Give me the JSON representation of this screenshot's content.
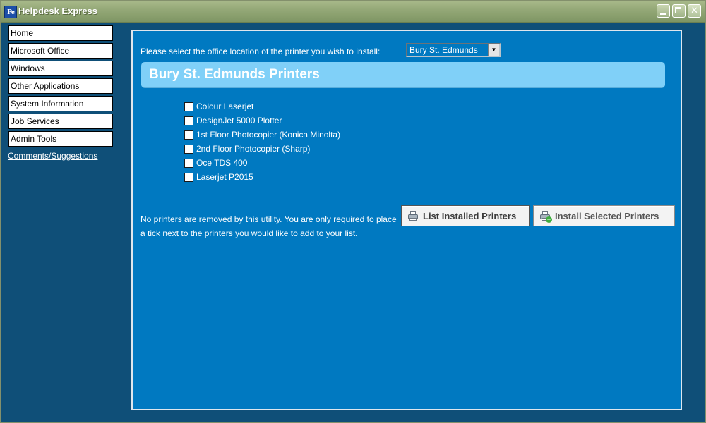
{
  "window": {
    "title": "Helpdesk Express",
    "icon_text": "Pe",
    "controls": {
      "minimize": "",
      "maximize": "",
      "close": "✕"
    }
  },
  "sidebar": {
    "items": [
      {
        "label": "Home"
      },
      {
        "label": "Microsoft Office"
      },
      {
        "label": "Windows"
      },
      {
        "label": "Other Applications"
      },
      {
        "label": "System Information"
      },
      {
        "label": "Job Services"
      },
      {
        "label": "Admin Tools"
      }
    ],
    "link": "Comments/Suggestions"
  },
  "main": {
    "prompt": "Please select the office location of the printer you wish to install:",
    "location_select": {
      "value": "Bury St. Edmunds"
    },
    "heading": "Bury St. Edmunds Printers",
    "printers": [
      {
        "label": "Colour Laserjet",
        "checked": false
      },
      {
        "label": "DesignJet 5000 Plotter",
        "checked": false
      },
      {
        "label": "1st Floor Photocopier (Konica Minolta)",
        "checked": false
      },
      {
        "label": "2nd Floor Photocopier (Sharp)",
        "checked": false
      },
      {
        "label": "Oce TDS 400",
        "checked": false
      },
      {
        "label": "Laserjet P2015",
        "checked": false
      }
    ],
    "note": "No printers are removed by this utility. You are only required to place a tick next to the printers you would like to add to your list.",
    "buttons": {
      "list_installed": "List Installed Printers",
      "install_selected": "Install Selected Printers"
    }
  },
  "colors": {
    "background": "#0f4f78",
    "panel": "#0079c1",
    "heading_bar": "#80d0f8",
    "titlebar": "#93a776"
  }
}
